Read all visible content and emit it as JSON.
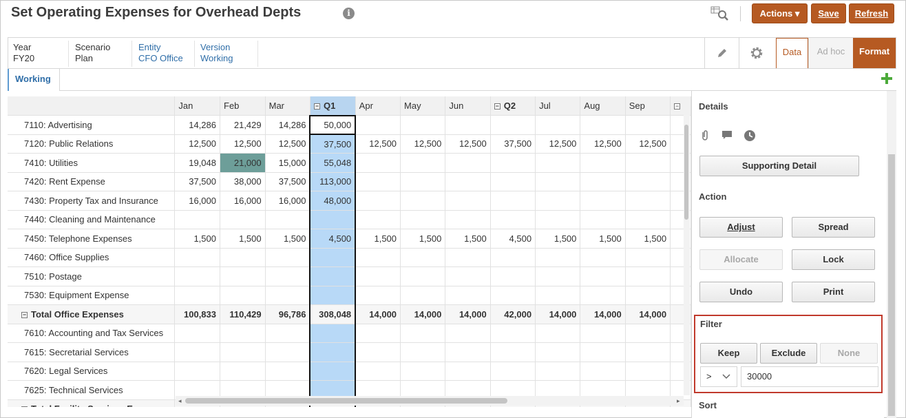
{
  "header": {
    "title": "Set Operating Expenses for Overhead Depts",
    "actions_label": "Actions",
    "save_label": "Save",
    "refresh_label": "Refresh"
  },
  "pov": [
    {
      "label": "Year",
      "value": "FY20",
      "link": false
    },
    {
      "label": "Scenario",
      "value": "Plan",
      "link": false
    },
    {
      "label": "Entity",
      "value": "CFO Office",
      "link": true
    },
    {
      "label": "Version",
      "value": "Working",
      "link": true
    }
  ],
  "view_tabs": {
    "data": "Data",
    "adhoc": "Ad hoc",
    "format": "Format"
  },
  "working_tab": "Working",
  "grid": {
    "columns": [
      "Jan",
      "Feb",
      "Mar",
      "Q1",
      "Apr",
      "May",
      "Jun",
      "Q2",
      "Jul",
      "Aug",
      "Sep"
    ],
    "rows": [
      {
        "label": "7110: Advertising",
        "values": [
          "14,286",
          "21,429",
          "14,286",
          "50,000",
          "",
          "",
          "",
          "",
          "",
          "",
          ""
        ]
      },
      {
        "label": "7120: Public Relations",
        "values": [
          "12,500",
          "12,500",
          "12,500",
          "37,500",
          "12,500",
          "12,500",
          "12,500",
          "37,500",
          "12,500",
          "12,500",
          "12,500"
        ]
      },
      {
        "label": "7410: Utilities",
        "values": [
          "19,048",
          "21,000",
          "15,000",
          "55,048",
          "",
          "",
          "",
          "",
          "",
          "",
          ""
        ]
      },
      {
        "label": "7420: Rent Expense",
        "values": [
          "37,500",
          "38,000",
          "37,500",
          "113,000",
          "",
          "",
          "",
          "",
          "",
          "",
          ""
        ]
      },
      {
        "label": "7430: Property Tax and Insurance",
        "values": [
          "16,000",
          "16,000",
          "16,000",
          "48,000",
          "",
          "",
          "",
          "",
          "",
          "",
          ""
        ]
      },
      {
        "label": "7440: Cleaning and Maintenance",
        "values": [
          "",
          "",
          "",
          "",
          "",
          "",
          "",
          "",
          "",
          "",
          ""
        ]
      },
      {
        "label": "7450: Telephone Expenses",
        "values": [
          "1,500",
          "1,500",
          "1,500",
          "4,500",
          "1,500",
          "1,500",
          "1,500",
          "4,500",
          "1,500",
          "1,500",
          "1,500"
        ]
      },
      {
        "label": "7460: Office Supplies",
        "values": [
          "",
          "",
          "",
          "",
          "",
          "",
          "",
          "",
          "",
          "",
          ""
        ]
      },
      {
        "label": "7510: Postage",
        "values": [
          "",
          "",
          "",
          "",
          "",
          "",
          "",
          "",
          "",
          "",
          ""
        ]
      },
      {
        "label": "7530: Equipment Expense",
        "values": [
          "",
          "",
          "",
          "",
          "",
          "",
          "",
          "",
          "",
          "",
          ""
        ]
      },
      {
        "label": "Total Office Expenses",
        "total": true,
        "values": [
          "100,833",
          "110,429",
          "96,786",
          "308,048",
          "14,000",
          "14,000",
          "14,000",
          "42,000",
          "14,000",
          "14,000",
          "14,000"
        ]
      },
      {
        "label": "7610: Accounting and Tax Services",
        "values": [
          "",
          "",
          "",
          "",
          "",
          "",
          "",
          "",
          "",
          "",
          ""
        ]
      },
      {
        "label": "7615: Secretarial Services",
        "values": [
          "",
          "",
          "",
          "",
          "",
          "",
          "",
          "",
          "",
          "",
          ""
        ]
      },
      {
        "label": "7620: Legal Services",
        "values": [
          "",
          "",
          "",
          "",
          "",
          "",
          "",
          "",
          "",
          "",
          ""
        ]
      },
      {
        "label": "7625: Technical Services",
        "values": [
          "",
          "",
          "",
          "",
          "",
          "",
          "",
          "",
          "",
          "",
          ""
        ]
      },
      {
        "label": "Total Facility Services Expenses",
        "total": true,
        "values": [
          "",
          "",
          "",
          "",
          "",
          "",
          "",
          "",
          "",
          "",
          ""
        ]
      }
    ]
  },
  "panel": {
    "details_title": "Details",
    "supporting_detail": "Supporting Detail",
    "action_title": "Action",
    "adjust": "Adjust",
    "spread": "Spread",
    "allocate": "Allocate",
    "lock": "Lock",
    "undo": "Undo",
    "print": "Print",
    "filter_title": "Filter",
    "keep": "Keep",
    "exclude": "Exclude",
    "none": "None",
    "operator": ">",
    "filter_value": "30000",
    "sort_title": "Sort"
  },
  "colors": {
    "accent": "#b65a22",
    "selected_column": "#b8d9f7",
    "highlight_cell": "#6d9e99",
    "filter_border": "#c0392b"
  }
}
